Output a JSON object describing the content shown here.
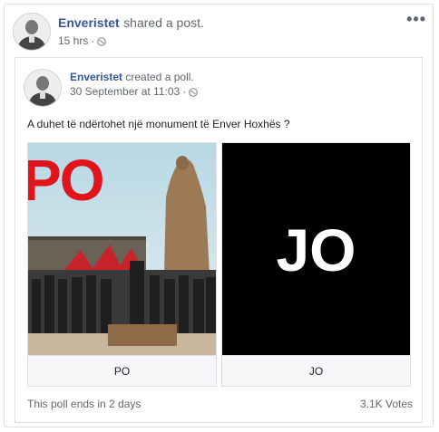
{
  "post": {
    "author": "Enveristet",
    "action": "shared a post.",
    "time": "15 hrs",
    "privacy_icon": "globe-icon",
    "more_icon": "more-options-icon",
    "more_label": "•••"
  },
  "shared_post": {
    "author": "Enveristet",
    "action": "created a poll.",
    "time": "30 September at 11:03",
    "privacy_icon": "globe-icon",
    "question": "A duhet të ndërtohet një monument të Enver Hoxhës ?",
    "options": [
      {
        "label": "PO",
        "image_text": "PO",
        "image_color": "#e0141b"
      },
      {
        "label": "JO",
        "image_text": "JO",
        "image_color": "#000000"
      }
    ],
    "poll_end": "This poll ends in 2 days",
    "votes": "3.1K Votes"
  }
}
